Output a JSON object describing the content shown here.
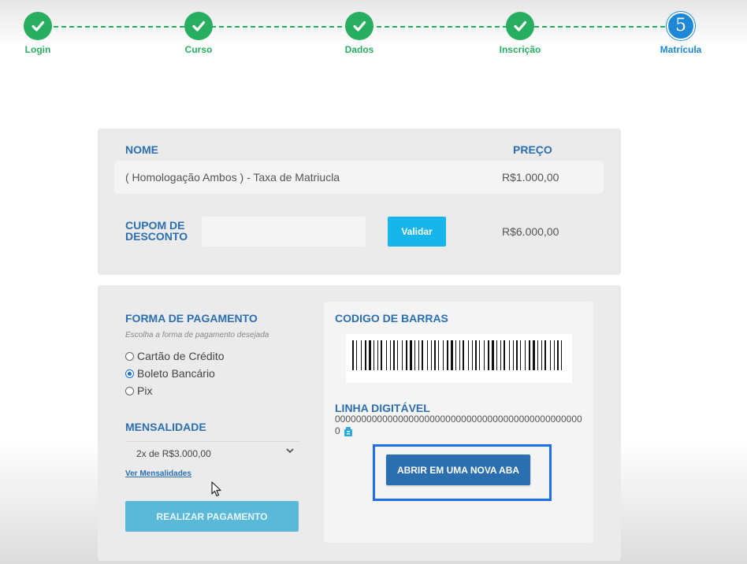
{
  "stepper": {
    "steps": [
      {
        "label": "Login",
        "state": "done"
      },
      {
        "label": "Curso",
        "state": "done"
      },
      {
        "label": "Dados",
        "state": "done"
      },
      {
        "label": "Inscrição",
        "state": "done"
      },
      {
        "label": "Matrícula",
        "state": "current",
        "number": "5"
      }
    ]
  },
  "order": {
    "name_header": "NOME",
    "price_header": "PREÇO",
    "item_name": "( Homologação Ambos ) - Taxa de Matriucla",
    "item_price": "R$1.000,00",
    "coupon_label": "CUPOM DE DESCONTO",
    "coupon_value": "",
    "validate_label": "Validar",
    "total": "R$6.000,00"
  },
  "payment": {
    "title": "FORMA DE PAGAMENTO",
    "hint": "Escolha a forma de pagamento desejada",
    "options": [
      {
        "label": "Cartão de Crédito",
        "checked": false
      },
      {
        "label": "Boleto Bancário",
        "checked": true
      },
      {
        "label": "Pix",
        "checked": false
      }
    ],
    "installments_title": "MENSALIDADE",
    "installment_selected": "2x de R$3.000,00",
    "installments_link": "Ver Mensalidades",
    "pay_button": "REALIZAR PAGAMENTO"
  },
  "barcode": {
    "title": "CODIGO DE BARRAS",
    "line_title": "LINHA DIGITÁVEL",
    "line_value": "000000000000000000000000000000000000000000000000",
    "open_button": "ABRIR EM UMA NOVA ABA"
  },
  "colors": {
    "success": "#27ae60",
    "current": "#1e88d6",
    "heading": "#2c6fb0",
    "validate": "#16b5ea",
    "highlight_frame": "#1e6fe8"
  },
  "icons": {
    "step_done": "check-icon",
    "copy": "copy-icon",
    "select": "chevron-down-icon",
    "cursor": "mouse-cursor-icon"
  }
}
